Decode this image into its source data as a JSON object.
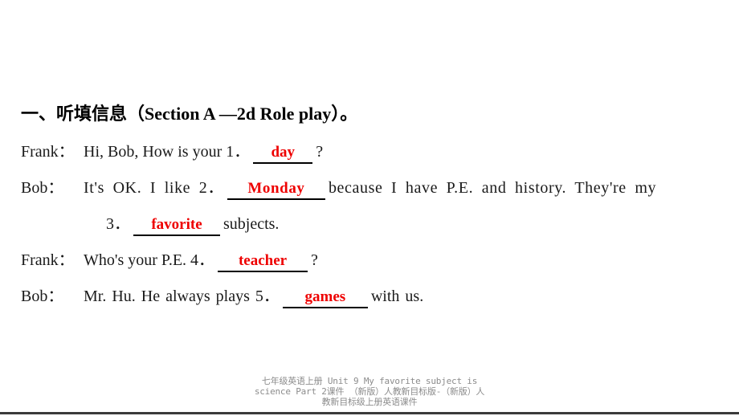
{
  "slide": {
    "background_color": "#ffffff",
    "answer_color": "#ee0000",
    "text_color": "#1a1a1a",
    "footer_color": "#8c8c8c"
  },
  "heading": {
    "text": "一、听填信息（Section A —2d Role play）。"
  },
  "dialogue": [
    {
      "id": "line-1",
      "speaker": "Frank：",
      "before": "Hi, Bob, How is your 1．",
      "answer": "day",
      "answer_number": "1",
      "after": "?"
    },
    {
      "id": "line-2",
      "speaker": "Bob：",
      "before": "It's OK. I like 2．",
      "answer": "Monday",
      "answer_number": "2",
      "after": "because I have P.E. and history. They're my"
    },
    {
      "id": "line-3",
      "speaker": "",
      "before": "3．",
      "answer": "favorite",
      "answer_number": "3",
      "after": "subjects."
    },
    {
      "id": "line-4",
      "speaker": "Frank：",
      "before": "Who's your P.E. 4．",
      "answer": "teacher",
      "answer_number": "4",
      "after": "?"
    },
    {
      "id": "line-5",
      "speaker": "Bob：",
      "before": "Mr. Hu. He always plays 5．",
      "answer": "games",
      "answer_number": "5",
      "after": "with us."
    }
  ],
  "footer": {
    "line1": "七年级英语上册 Unit 9 My favorite subject is",
    "line2": "science Part 2课件 （新版）人教新目标版-（新版）人",
    "line3": "教新目标级上册英语课件"
  }
}
